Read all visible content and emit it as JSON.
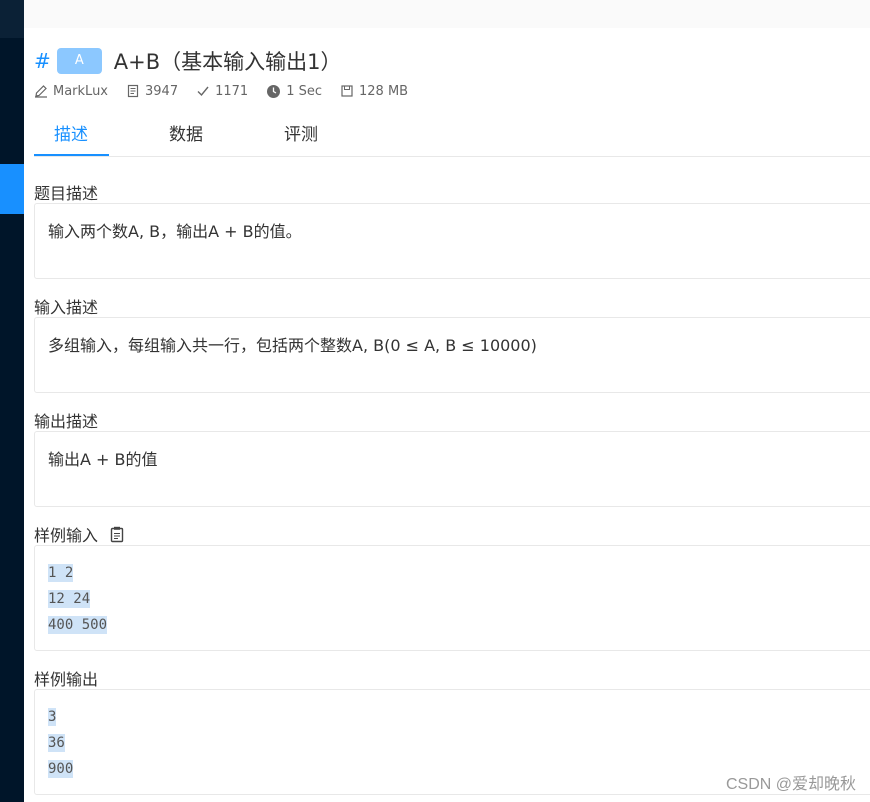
{
  "problem": {
    "hash": "#",
    "badge": "A",
    "title": "A+B（基本输入输出1）",
    "meta": {
      "author": "MarkLux",
      "submissions": "3947",
      "accepted": "1171",
      "time_limit": "1 Sec",
      "memory_limit": "128 MB"
    }
  },
  "tabs": [
    {
      "label": "描述",
      "active": true
    },
    {
      "label": "数据",
      "active": false
    },
    {
      "label": "评测",
      "active": false
    }
  ],
  "sections": {
    "description": {
      "title": "题目描述",
      "text": "输入两个数A, B，输出A + B的值。"
    },
    "input": {
      "title": "输入描述",
      "text": "多组输入，每组输入共一行，包括两个整数A, B(0 ≤ A, B ≤ 10000)"
    },
    "output": {
      "title": "输出描述",
      "text": "输出A + B的值"
    },
    "sample_input": {
      "title": "样例输入",
      "lines": [
        "1 2",
        "12 24",
        "400 500"
      ]
    },
    "sample_output": {
      "title": "样例输出",
      "lines": [
        "3",
        "36",
        "900"
      ]
    }
  },
  "icons": {
    "author": "edit-icon",
    "submissions": "file-icon",
    "accepted": "check-icon",
    "time": "clock-icon",
    "memory": "save-icon",
    "copy": "copy-icon"
  },
  "colors": {
    "accent": "#1890ff",
    "sidebar": "#001529",
    "badge": "#8cc8ff",
    "code_highlight": "#cfe3f7"
  },
  "watermark": "CSDN @爱却晚秋"
}
